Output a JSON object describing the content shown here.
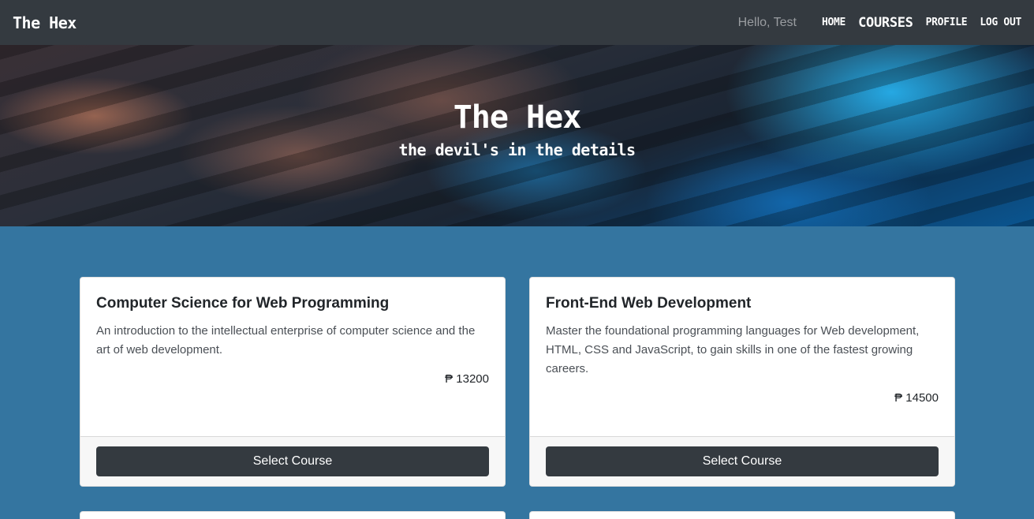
{
  "navbar": {
    "brand": "The Hex",
    "greeting": "Hello, Test",
    "links": [
      {
        "label": "Home"
      },
      {
        "label": "Courses"
      },
      {
        "label": "Profile"
      },
      {
        "label": "Log Out"
      }
    ],
    "active": "Courses"
  },
  "hero": {
    "title": "The Hex",
    "subtitle": "the devil's in the details"
  },
  "courses": [
    {
      "title": "Computer Science for Web  Programming",
      "description": "An introduction to the intellectual enterprise of computer science and the art of web development.",
      "price": "₱ 13200",
      "button": "Select Course"
    },
    {
      "title": "Front-End Web  Development",
      "description": "Master the foundational programming languages for Web development, HTML, CSS and JavaScript, to gain skills in one of the fastest growing careers.",
      "price": "₱ 14500",
      "button": "Select Course"
    }
  ],
  "colors": {
    "navbar": "#343a40",
    "page_background": "#3475a0",
    "button": "#343a40"
  }
}
